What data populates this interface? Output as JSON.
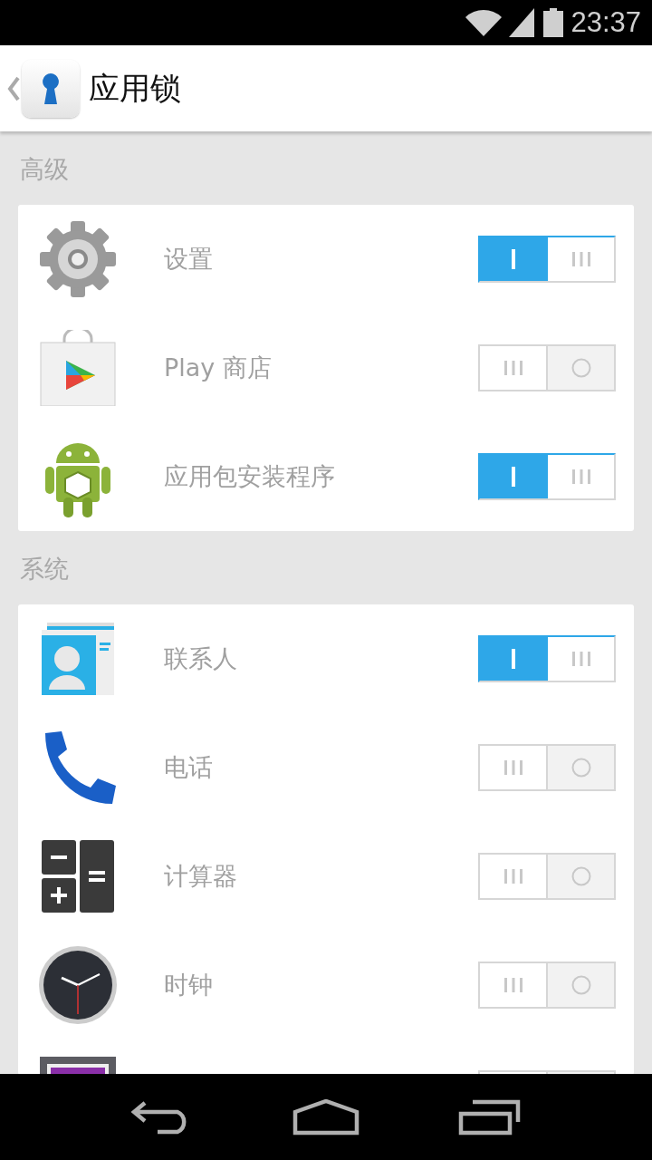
{
  "status_bar": {
    "time": "23:37"
  },
  "header": {
    "title": "应用锁"
  },
  "sections": [
    {
      "title": "高级",
      "apps": [
        {
          "label": "设置",
          "on": true
        },
        {
          "label": "Play 商店",
          "on": false
        },
        {
          "label": "应用包安装程序",
          "on": true
        }
      ]
    },
    {
      "title": "系统",
      "apps": [
        {
          "label": "联系人",
          "on": true
        },
        {
          "label": "电话",
          "on": false
        },
        {
          "label": "计算器",
          "on": false
        },
        {
          "label": "时钟",
          "on": false
        },
        {
          "kind": "cut",
          "on": false
        }
      ]
    }
  ]
}
